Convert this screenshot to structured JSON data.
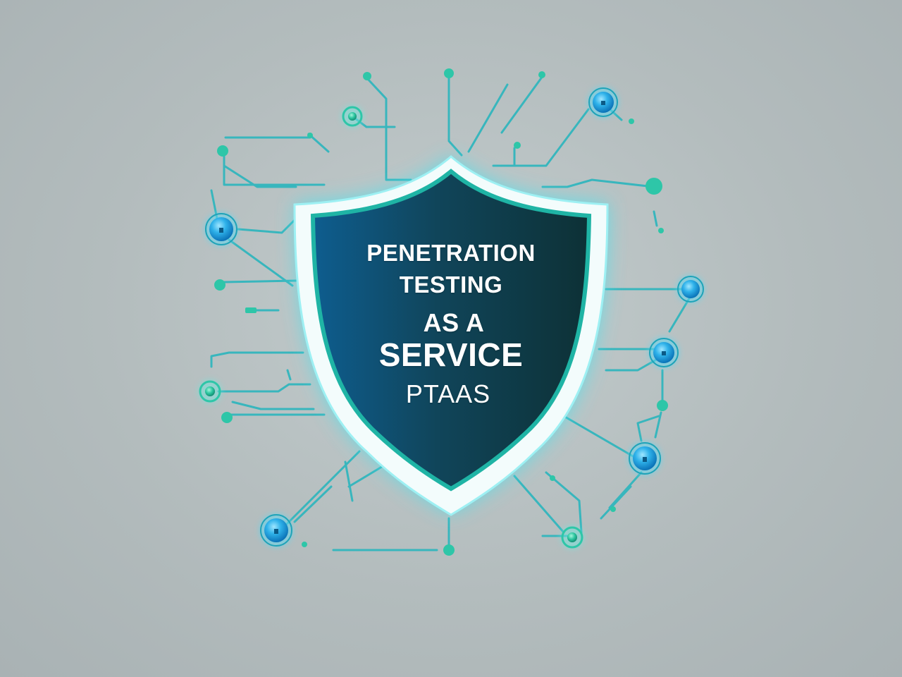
{
  "shield": {
    "line1": "PENETRATION",
    "line2": "TESTING",
    "line3": "AS A",
    "line4": "SERVICE",
    "line5": "PTAAS"
  },
  "colors": {
    "background": "#b8c1c2",
    "shield_inner_dark": "#0f3b44",
    "shield_inner_blue": "#0e5d8f",
    "shield_rim": "#f2fbfb",
    "shield_glow": "#3fe0ee",
    "circuit_line": "#3bb8bf",
    "node_blue": "#2fa9e0",
    "node_green": "#2cc6a0"
  },
  "icons": [
    "shield-icon",
    "lock-node-icon",
    "circuit-node-icon"
  ]
}
